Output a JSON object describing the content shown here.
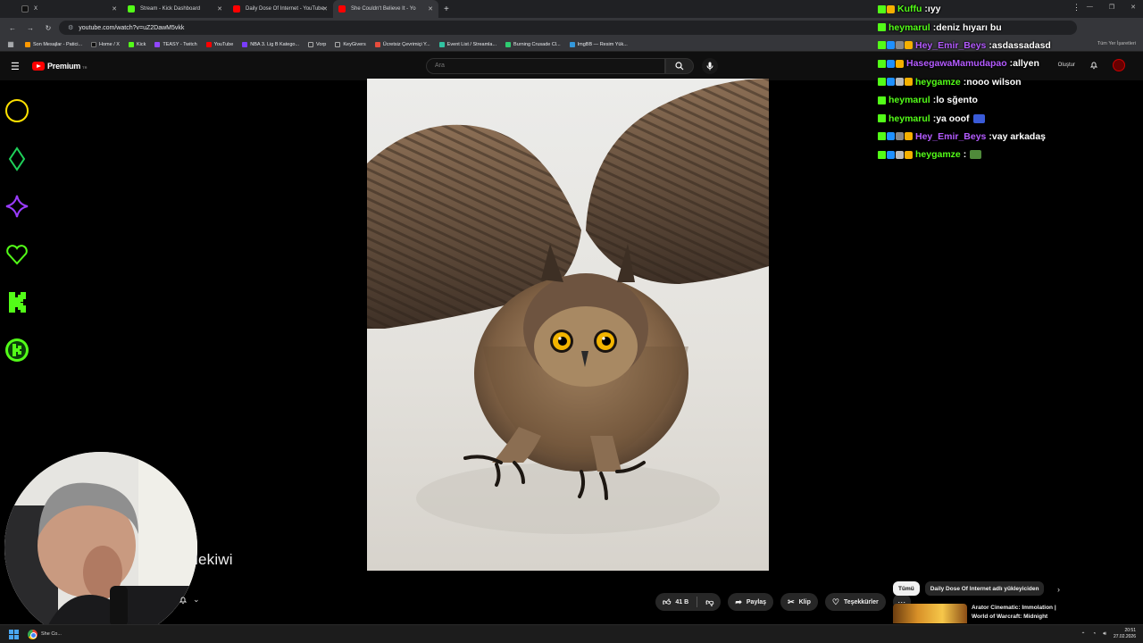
{
  "browser": {
    "tabs": [
      {
        "title": "X",
        "favicon_color": "#111111",
        "active": false
      },
      {
        "title": "Stream - Kick Dashboard",
        "favicon_color": "#53fc18",
        "active": false
      },
      {
        "title": "Daily Dose Of Internet - YouTube",
        "favicon_color": "#ff0000",
        "active": false
      },
      {
        "title": "She Couldn't Believe It - Yo",
        "favicon_color": "#ff0000",
        "active": true
      }
    ],
    "new_tab": "+",
    "url": "youtube.com/watch?v=uZ2DawM5vkk",
    "bookmarks": [
      {
        "label": "Son Mesajlar - Patici...",
        "color": "#ff9900"
      },
      {
        "label": "Home / X",
        "color": "#111111"
      },
      {
        "label": "Kick",
        "color": "#53fc18"
      },
      {
        "label": "TEASY - Twitch",
        "color": "#9146ff"
      },
      {
        "label": "YouTube",
        "color": "#ff0000"
      },
      {
        "label": "NBA 3. Lig B Katego...",
        "color": "#7a3cff"
      },
      {
        "label": "Vorp",
        "color": "#888888"
      },
      {
        "label": "KeyGivers",
        "color": "#888888"
      },
      {
        "label": "Ücretsiz Çevrimiçi Y...",
        "color": "#e74c3c"
      },
      {
        "label": "Event List / Streamla...",
        "color": "#31c3a2"
      },
      {
        "label": "Burning Crusade Cl...",
        "color": "#2ecc71"
      },
      {
        "label": "ImgBB — Resim Yük...",
        "color": "#3498db"
      }
    ],
    "bookmarks_right": "Tüm Yer İşaretleri"
  },
  "youtube": {
    "brand": "Premium",
    "region": "TR",
    "search_placeholder": "Ara",
    "create_label": "Oluştur",
    "like_count": "41 B",
    "share_label": "Paylaş",
    "clip_label": "Klip",
    "thanks_label": "Teşekkürler",
    "chips": [
      {
        "label": "Tümü",
        "selected": true
      },
      {
        "label": "Daily Dose Of Internet adlı yükleyiciden",
        "selected": false
      }
    ],
    "recommendation": {
      "title": "Arator Cinematic: Immolation | World of Warcraft: Midnight"
    }
  },
  "overlay": {
    "side_icons": [
      "circle-icon",
      "diamond-icon",
      "star-icon",
      "heart-icon",
      "kick-k-icon",
      "kick-coin-icon"
    ],
    "streamer_name_partial": "lekiwi"
  },
  "chat": [
    {
      "user": "Kuffu",
      "user_color": "#53fc18",
      "message": "ıyy",
      "badges": [
        "#53fc18",
        "#f5b000"
      ]
    },
    {
      "user": "heymarul",
      "user_color": "#53fc18",
      "message": "deniz hıyarı bu",
      "badges": [
        "#53fc18"
      ]
    },
    {
      "user": "Hey_Emir_Beys",
      "user_color": "#b45bff",
      "message": "asdassadasd",
      "badges": [
        "#53fc18",
        "#1e90ff",
        "#888888",
        "#f5b000"
      ]
    },
    {
      "user": "HasegawaMamudapao",
      "user_color": "#b45bff",
      "message": "allyen",
      "badges": [
        "#53fc18",
        "#1e90ff",
        "#f5b000"
      ]
    },
    {
      "user": "heygamze",
      "user_color": "#53fc18",
      "message": "nooo wilson",
      "badges": [
        "#53fc18",
        "#1e90ff",
        "#bbbbbb",
        "#f5b000"
      ]
    },
    {
      "user": "heymarul",
      "user_color": "#53fc18",
      "message": "lo sğento",
      "badges": [
        "#53fc18"
      ]
    },
    {
      "user": "heymarul",
      "user_color": "#53fc18",
      "message": "ya ooof",
      "badges": [
        "#53fc18"
      ],
      "emote": "#3a5bd8"
    },
    {
      "user": "Hey_Emir_Beys",
      "user_color": "#b45bff",
      "message": "vay arkadaş",
      "badges": [
        "#53fc18",
        "#1e90ff",
        "#888888",
        "#f5b000"
      ]
    },
    {
      "user": "heygamze",
      "user_color": "#53fc18",
      "message": "",
      "badges": [
        "#53fc18",
        "#1e90ff",
        "#bbbbbb",
        "#f5b000"
      ],
      "emote": "#4f8a3a"
    }
  ],
  "taskbar": {
    "app_label": "She Co...",
    "time": "20:51",
    "date": "27.02.2026"
  }
}
